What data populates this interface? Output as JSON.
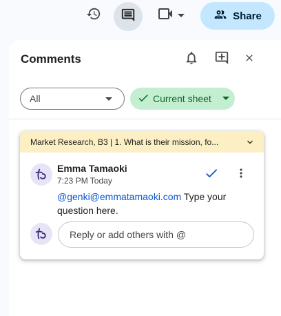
{
  "toolbar": {
    "history_icon": "history-icon",
    "comments_icon": "comments-icon",
    "meet_icon": "video-camera-icon",
    "share_label": "Share",
    "share_icon": "people-icon",
    "share_color": "#c2e7ff"
  },
  "panel": {
    "title": "Comments",
    "icons": [
      "bell-icon",
      "add-comment-icon",
      "close-icon"
    ]
  },
  "filters": {
    "all_label": "All",
    "sheet_label": "Current sheet",
    "sheet_color": "#c4eed0"
  },
  "comment": {
    "reference": "Market Research,  B3  |  1. What is their mission, fo...",
    "header_color": "#fdefc4",
    "author": "Emma Tamaoki",
    "time": "7:23 PM Today",
    "mention": "@genki@emmatamaoki.com",
    "text": " Type your question here.",
    "reply_placeholder": "Reply or add others with @"
  }
}
